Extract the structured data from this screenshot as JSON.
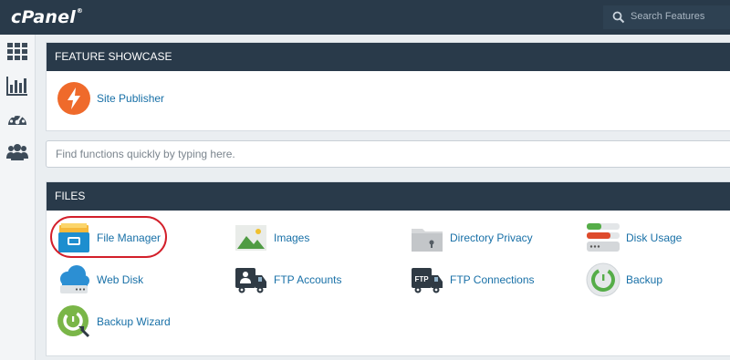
{
  "header": {
    "logo": "cPanel",
    "logo_reg": "®",
    "search_label": "Search Features"
  },
  "sidebar": {
    "items": [
      {
        "name": "home",
        "icon": "grid-icon"
      },
      {
        "name": "statistics",
        "icon": "bar-chart-icon"
      },
      {
        "name": "dashboard",
        "icon": "gauge-icon"
      },
      {
        "name": "user-manager",
        "icon": "users-icon"
      }
    ]
  },
  "feature_showcase": {
    "title": "FEATURE SHOWCASE",
    "items": [
      {
        "label": "Site Publisher",
        "icon": "lightning-icon",
        "color": "#ef6a2b"
      }
    ]
  },
  "quick_find": {
    "placeholder": "Find functions quickly by typing here."
  },
  "files": {
    "title": "FILES",
    "items": [
      {
        "label": "File Manager",
        "icon": "file-manager-icon",
        "highlighted": true
      },
      {
        "label": "Images",
        "icon": "images-icon"
      },
      {
        "label": "Directory Privacy",
        "icon": "folder-lock-icon"
      },
      {
        "label": "Disk Usage",
        "icon": "disk-usage-icon"
      },
      {
        "label": "Web Disk",
        "icon": "cloud-drive-icon"
      },
      {
        "label": "FTP Accounts",
        "icon": "ftp-truck-icon"
      },
      {
        "label": "FTP Connections",
        "icon": "ftp-connections-icon"
      },
      {
        "label": "Backup",
        "icon": "backup-icon"
      },
      {
        "label": "Backup Wizard",
        "icon": "backup-wizard-icon"
      }
    ]
  },
  "colors": {
    "header_bg": "#293a4a",
    "link": "#1870a7",
    "highlight_ring": "#d31f2a"
  }
}
